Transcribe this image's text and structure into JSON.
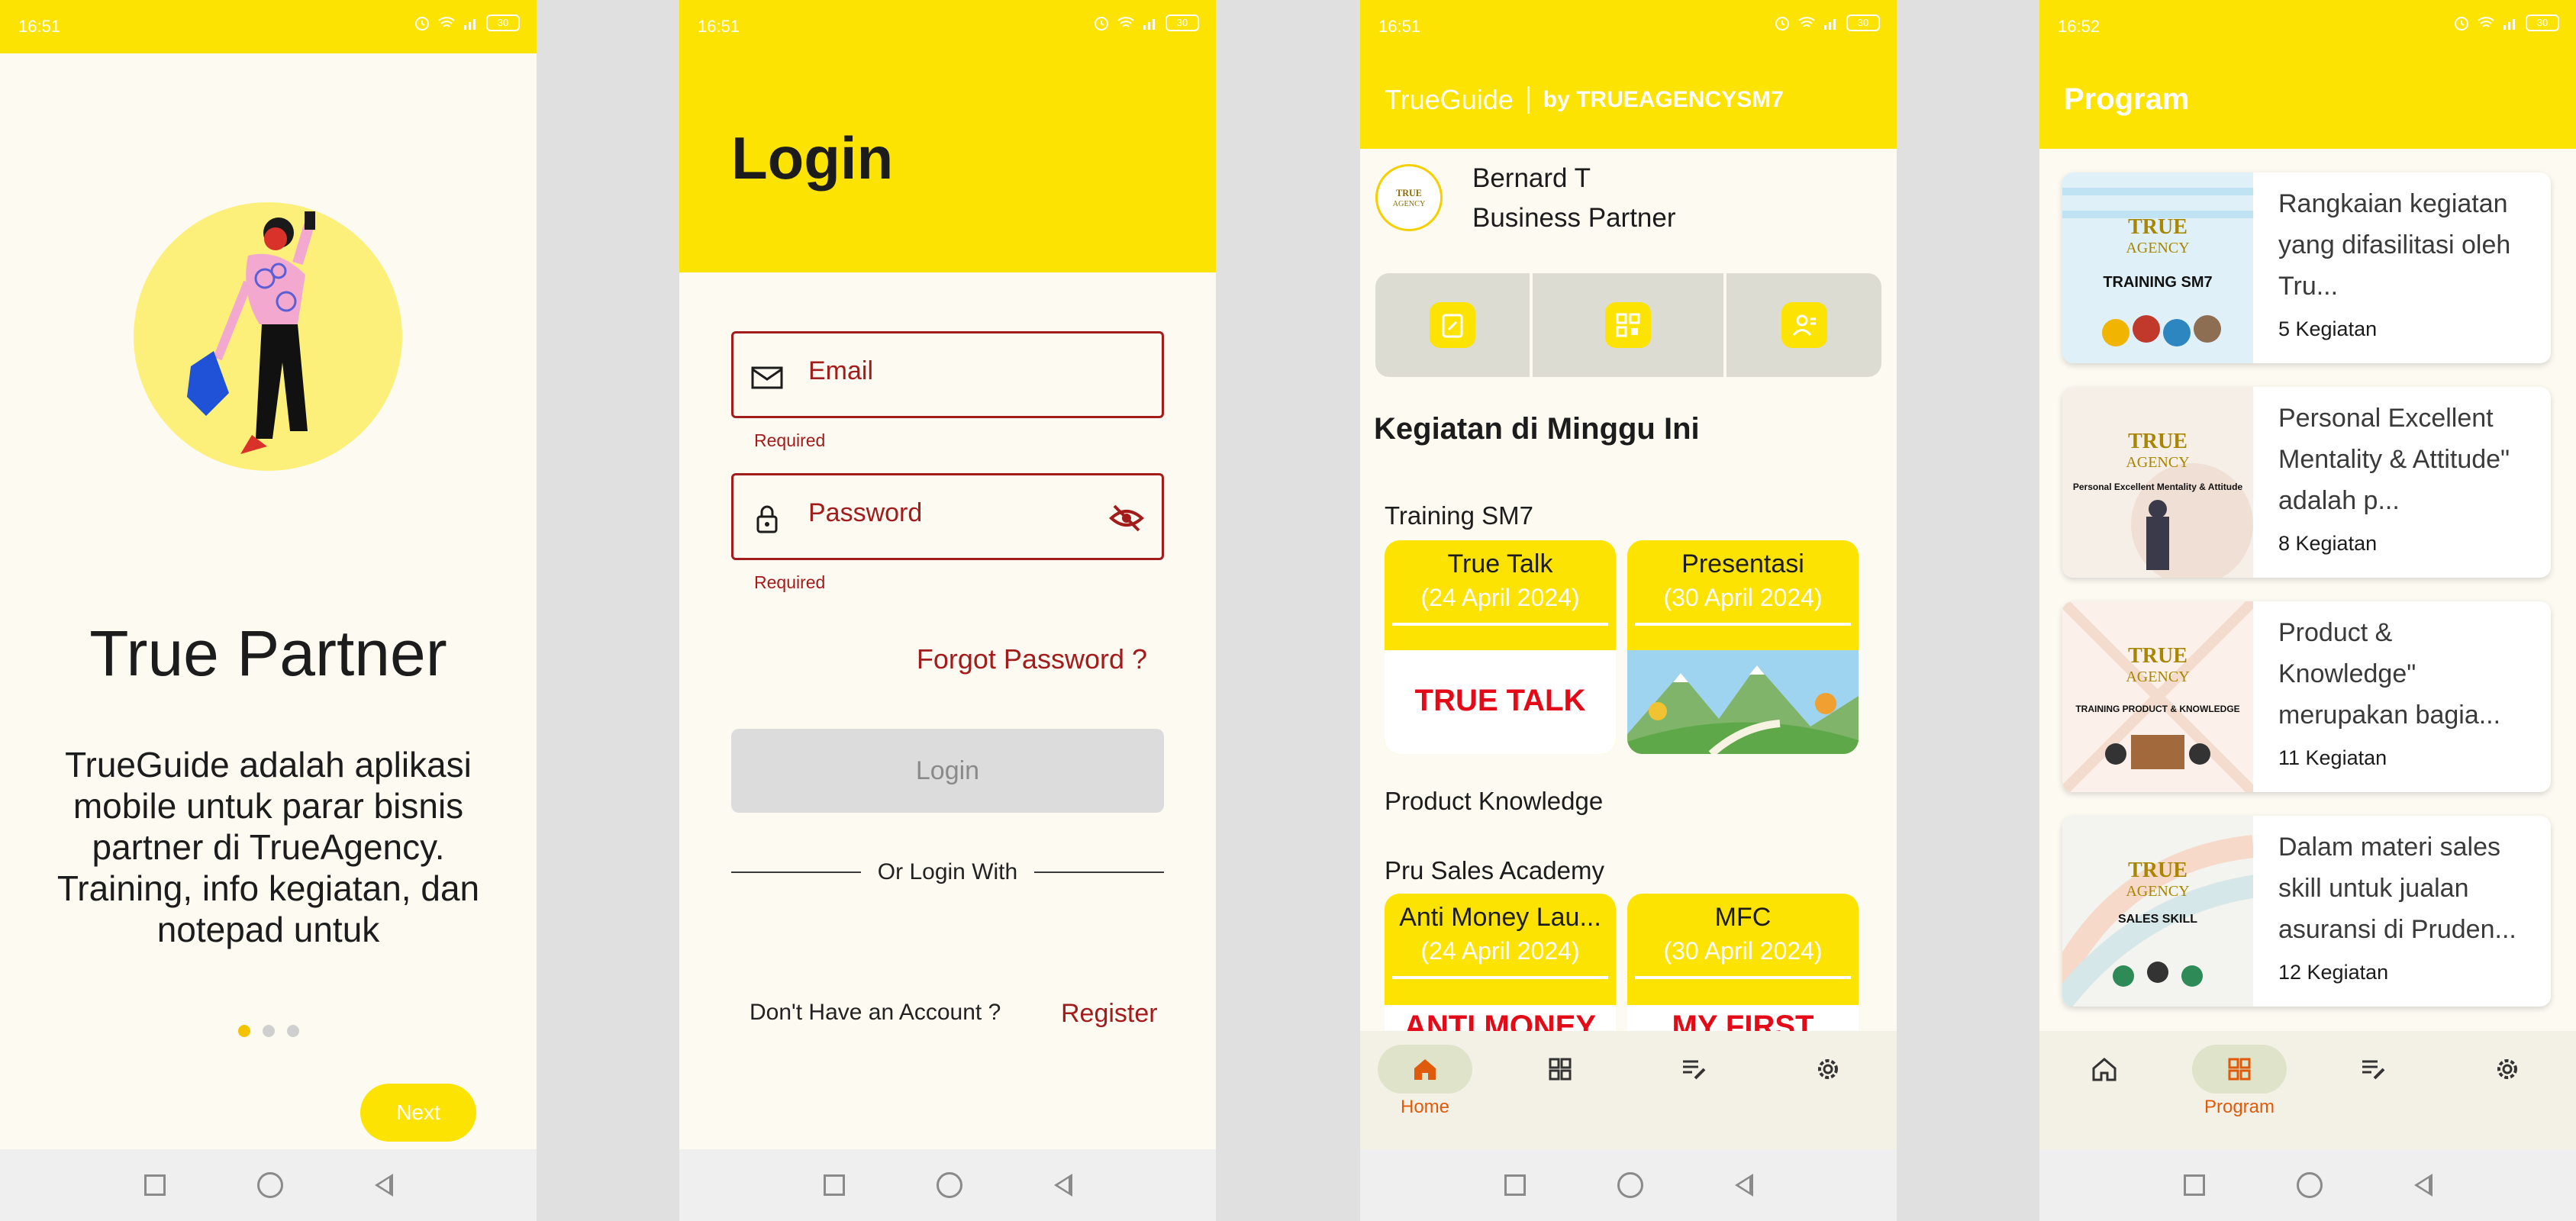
{
  "colors": {
    "brand_yellow": "#fde301",
    "accent_red": "#a31c1c",
    "active_orange": "#e05a0b"
  },
  "status_times": [
    "16:51",
    "16:51",
    "16:51",
    "16:52"
  ],
  "battery": "30",
  "onboarding": {
    "title": "True Partner",
    "description": "TrueGuide adalah aplikasi mobile untuk parar bisnis partner di TrueAgency. Training, info kegiatan, dan notepad untuk",
    "next_label": "Next"
  },
  "login": {
    "title": "Login",
    "email_placeholder": "Email",
    "password_placeholder": "Password",
    "required_text": "Required",
    "forgot_label": "Forgot Password ?",
    "login_button": "Login",
    "or_login_with": "Or Login With",
    "no_account": "Don't Have an Account ?",
    "register_label": "Register"
  },
  "home": {
    "brand": "TrueGuide",
    "brand_by": "by TRUEAGENCYSM7",
    "user_name": "Bernard T",
    "user_role": "Business Partner",
    "section_title": "Kegiatan di Minggu Ini",
    "categories": [
      {
        "name": "Training SM7",
        "items": [
          {
            "title": "True Talk",
            "date": "(24 April 2024)",
            "image_text": "TRUE TALK"
          },
          {
            "title": "Presentasi",
            "date": "(30 April 2024)",
            "image_text": ""
          }
        ]
      },
      {
        "name": "Product Knowledge",
        "items": []
      },
      {
        "name": "Pru Sales Academy",
        "items": [
          {
            "title": "Anti Money Lau...",
            "date": "(24 April 2024)",
            "image_text": "ANTI MONEY"
          },
          {
            "title": "MFC",
            "date": "(30 April 2024)",
            "image_text": "MY FIRST"
          }
        ]
      }
    ]
  },
  "bottom_nav": {
    "home_label": "Home",
    "program_label": "Program"
  },
  "program": {
    "title": "Program",
    "items": [
      {
        "description": "Rangkaian kegiatan yang difasilitasi oleh Tru...",
        "count": "5 Kegiatan",
        "thumb_title": "TRAINING SM7"
      },
      {
        "description": "Personal Excellent Mentality & Attitude\" adalah p...",
        "count": "8 Kegiatan",
        "thumb_title": "Personal Excellent Mentality & Attitude"
      },
      {
        "description": "Product & Knowledge\" merupakan bagia...",
        "count": "11 Kegiatan",
        "thumb_title": "TRAINING PRODUCT & KNOWLEDGE"
      },
      {
        "description": "Dalam materi sales skill untuk jualan asuransi di Pruden...",
        "count": "12 Kegiatan",
        "thumb_title": "SALES SKILL"
      }
    ],
    "logo_text": "TRUE AGENCY"
  }
}
